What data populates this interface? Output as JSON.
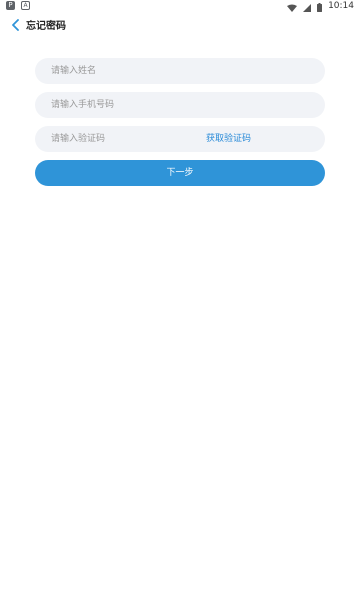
{
  "status_bar": {
    "time": "10:14",
    "icons": [
      "notification-p-icon",
      "notification-a-icon",
      "wifi-icon",
      "signal-icon",
      "battery-icon"
    ]
  },
  "header": {
    "title": "忘记密码",
    "back_icon": "chevron-left-icon"
  },
  "form": {
    "name_placeholder": "请输入姓名",
    "phone_placeholder": "请输入手机号码",
    "code_placeholder": "请输入验证码",
    "get_code_label": "获取验证码",
    "next_label": "下一步"
  },
  "colors": {
    "accent": "#2f94d8",
    "link": "#2a8bd8",
    "input_bg": "#f1f3f7"
  }
}
